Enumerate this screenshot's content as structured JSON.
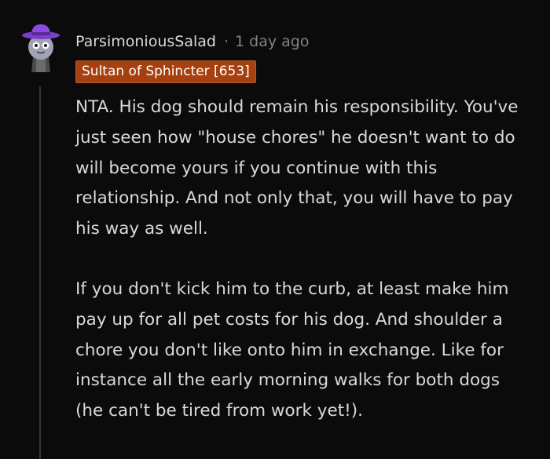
{
  "comment": {
    "author": "ParsimoniousSalad",
    "separator": "·",
    "timestamp": "1 day ago",
    "flair": "Sultan of Sphincter [653]",
    "paragraphs": [
      "NTA. His dog should remain his responsibility. You've just seen how \"house chores\" he doesn't want to do will become yours if you continue with this relationship. And not only that, you will have to pay his way as well.",
      "If you don't kick him to the curb, at least make him pay up for all pet costs for his dog. And shoulder a chore you don't like onto him in exchange. Like for instance all the early morning walks for both dogs (he can't be tired from work yet!)."
    ]
  },
  "colors": {
    "background": "#0b0b0b",
    "text": "#d7dadc",
    "muted": "#818384",
    "flair_background": "#a6410f",
    "thread_line": "#343536",
    "avatar_hat": "#7c3fc9"
  },
  "icons": {
    "avatar": "snoo-avatar-purple-hat"
  }
}
